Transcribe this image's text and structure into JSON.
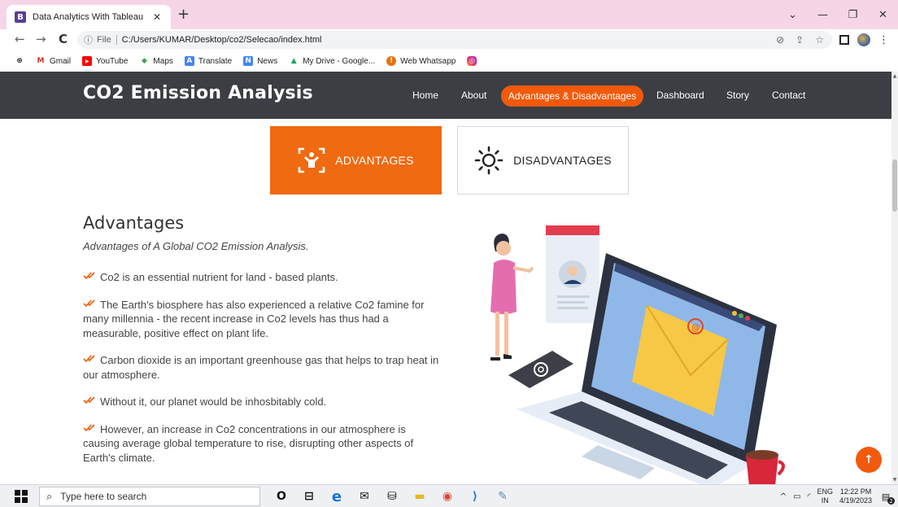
{
  "browser": {
    "tab_title": "Data Analytics With Tableau",
    "tab_favicon": "B",
    "tab_close": "✕",
    "new_tab": "+",
    "window_controls": [
      "⌄",
      "—",
      "❐",
      "✕"
    ],
    "nav": {
      "back": "←",
      "forward": "→",
      "reload": "C"
    },
    "omnibox": {
      "info_icon": "ⓘ",
      "scheme_label": "File",
      "url": "C:/Users/KUMAR/Desktop/co2/Selecao/index.html"
    },
    "omnibox_icons": [
      "eye-off-icon",
      "share-icon",
      "star-icon"
    ],
    "bookmarks": [
      {
        "label": "Gmail",
        "icon": "M",
        "color": "#d93025"
      },
      {
        "label": "YouTube",
        "icon": "▶",
        "color": "#ff0000"
      },
      {
        "label": "Maps",
        "icon": "⬤",
        "color": "#34a853"
      },
      {
        "label": "Translate",
        "icon": "A",
        "color": "#4285f4"
      },
      {
        "label": "News",
        "icon": "N",
        "color": "#4285f4"
      },
      {
        "label": "My Drive - Google...",
        "icon": "▲",
        "color": "#1fa463"
      },
      {
        "label": "Web Whatsapp",
        "icon": "!",
        "color": "#e8710a"
      }
    ]
  },
  "site": {
    "logo": "CO2 Emission Analysis",
    "nav": {
      "home": "Home",
      "about": "About",
      "advantages": "Advantages & Disadvantages",
      "dashboard": "Dashboard",
      "story": "Story",
      "contact": "Contact"
    },
    "tabs": {
      "advantages": "ADVANTAGES",
      "disadvantages": "DISADVANTAGES"
    },
    "heading": "Advantages",
    "subheading": "Advantages of A Global CO2 Emission Analysis.",
    "points": [
      "Co2 is an essential nutrient for land - based plants.",
      "The Earth's biosphere has also experienced a relative Co2 famine for many millennia - the recent increase in Co2 levels has thus had a measurable, positive effect on plant life.",
      "Carbon dioxide is an important greenhouse gas that helps to trap heat in our atmosphere.",
      "Without it, our planet would be inhosbitably cold.",
      "However, an increase in Co2 concentrations in our atmosphere is causing average global temperature to rise, disrupting other aspects of Earth's climate."
    ],
    "accent_color": "#f15a0c",
    "header_color": "#3c3e44",
    "scroll_top": "↑"
  },
  "taskbar": {
    "search_placeholder": "Type here to search",
    "search_icon": "⌕",
    "apps": [
      {
        "name": "cortana-icon",
        "glyph": "O",
        "color": "#111111"
      },
      {
        "name": "task-view-icon",
        "glyph": "⊟",
        "color": "#111111"
      },
      {
        "name": "edge-icon",
        "glyph": "e",
        "color": "#1a73d9"
      },
      {
        "name": "mail-icon",
        "glyph": "✉",
        "color": "#111111"
      },
      {
        "name": "store-icon",
        "glyph": "⛁",
        "color": "#111111"
      },
      {
        "name": "file-explorer-icon",
        "glyph": "▬",
        "color": "#e8b820"
      },
      {
        "name": "chrome-icon",
        "glyph": "◉",
        "color": "#db4437"
      },
      {
        "name": "vscode-icon",
        "glyph": "⟩",
        "color": "#1a7fd4"
      },
      {
        "name": "paint-icon",
        "glyph": "✎",
        "color": "#6a8aa8"
      }
    ],
    "tray_up": "^",
    "tray_battery": "▭",
    "tray_wifi": "◜",
    "lang_top": "ENG",
    "lang_bottom": "IN",
    "time": "12:22 PM",
    "date": "4/19/2023",
    "notification_count": "2"
  }
}
